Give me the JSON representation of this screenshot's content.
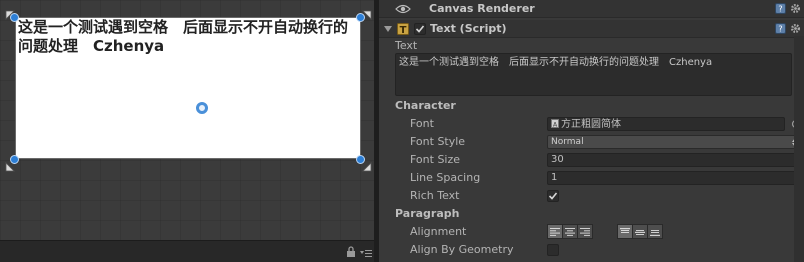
{
  "scene": {
    "canvas_text": "这是一个测试遇到空格　后面显示不开自动换行的问题处理　Czhenya"
  },
  "inspector": {
    "canvas_renderer": {
      "title": "Canvas Renderer"
    },
    "text_script": {
      "title": "Text (Script)",
      "text_label": "Text",
      "text_value": "这是一个测试遇到空格　后面显示不开自动换行的问题处理　Czhenya",
      "character_section": "Character",
      "font_label": "Font",
      "font_value": "方正粗圆简体",
      "font_style_label": "Font Style",
      "font_style_value": "Normal",
      "font_size_label": "Font Size",
      "font_size_value": "30",
      "line_spacing_label": "Line Spacing",
      "line_spacing_value": "1",
      "rich_text_label": "Rich Text",
      "rich_text_checked": true,
      "paragraph_section": "Paragraph",
      "alignment_label": "Alignment",
      "align_by_geometry_label": "Align By Geometry",
      "align_by_geometry_checked": false
    }
  }
}
